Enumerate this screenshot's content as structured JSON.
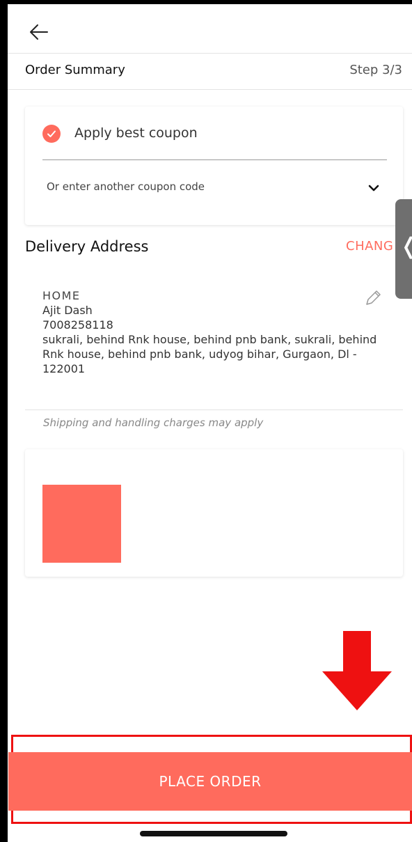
{
  "header": {
    "title": "Order Summary",
    "step": "Step 3/3",
    "back_icon": "arrow-left-icon"
  },
  "coupon": {
    "apply_label": "Apply best coupon",
    "apply_checked": true,
    "other_code_label": "Or enter another coupon code",
    "check_icon": "check-icon",
    "expand_icon": "chevron-down-icon"
  },
  "delivery": {
    "title": "Delivery Address",
    "change_label": "CHANG",
    "side_tab_glyph": "❬",
    "address": {
      "label": "HOME",
      "name": "Ajit Dash",
      "phone": "7008258118",
      "line": "sukrali, behind Rnk house, behind pnb bank, sukrali, behind Rnk house, behind pnb bank, udyog bihar, Gurgaon, Dl - 122001"
    },
    "edit_icon": "pencil-icon",
    "shipping_note": "Shipping and handling charges may apply"
  },
  "product": {
    "image_color": "#ff6b5d"
  },
  "cta": {
    "place_order_label": "PLACE ORDER"
  },
  "colors": {
    "accent": "#ff6b5d",
    "highlight": "#ee1111"
  }
}
